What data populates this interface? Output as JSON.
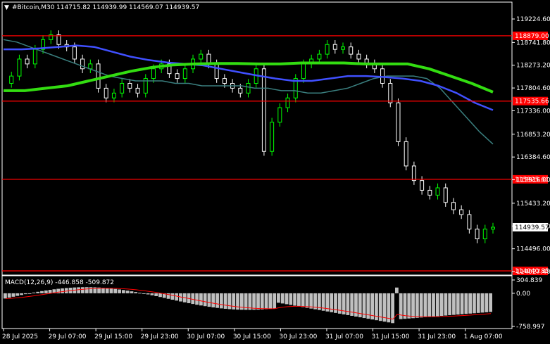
{
  "header": {
    "symbol_timeframe": "#Bitcoin,M30",
    "ohlc": "114715.82 114939.99 114569.07 114939.57",
    "menu_glyph": "▼"
  },
  "price_axis": {
    "ticks": [
      "119224.60",
      "118741.80",
      "118273.20",
      "117804.60",
      "117336.00",
      "116853.20",
      "116384.60",
      "115916.00",
      "115433.20",
      "114964.60",
      "114496.00",
      "114027.40"
    ],
    "current_price": "114939.57"
  },
  "level_lines": [
    {
      "price": "118879.00",
      "value": 118879.0
    },
    {
      "price": "117535.66",
      "value": 117535.66
    },
    {
      "price": "115925.61",
      "value": 115925.61
    },
    {
      "price": "114040.85",
      "value": 114040.85
    }
  ],
  "macd": {
    "label": "MACD(12,26,9) -446.858 -509.872",
    "ticks": [
      "304.839",
      "0.00",
      "-758.997"
    ]
  },
  "time_axis": [
    "28 Jul 2025",
    "29 Jul 07:00",
    "29 Jul 15:00",
    "29 Jul 23:00",
    "30 Jul 07:00",
    "30 Jul 15:00",
    "30 Jul 23:00",
    "31 Jul 07:00",
    "31 Jul 15:00",
    "31 Jul 23:00",
    "1 Aug 07:00"
  ],
  "colors": {
    "background": "#000000",
    "up_candle": "#00ff00",
    "down_candle": "#ffffff",
    "level": "#ff0000",
    "ma_fast": "#3a7f7f",
    "ma_mid": "#4050ff",
    "ma_slow": "#33dd11",
    "macd_hist": "#c0c0c0",
    "macd_signal": "#ff0000"
  },
  "chart_data": {
    "type": "candlestick",
    "title": "#Bitcoin,M30",
    "ylim": [
      114027.4,
      119224.6
    ],
    "close_series": [
      117900,
      118050,
      118400,
      118300,
      118600,
      118800,
      118900,
      118700,
      118650,
      118400,
      118200,
      118300,
      117800,
      117600,
      117700,
      117900,
      117800,
      117700,
      118000,
      118200,
      118300,
      118100,
      118000,
      118200,
      118400,
      118500,
      118300,
      118000,
      117900,
      117800,
      117700,
      117900,
      118200,
      116500,
      117100,
      117400,
      117600,
      118000,
      118300,
      118400,
      118500,
      118700,
      118600,
      118650,
      118500,
      118400,
      118300,
      118200,
      117900,
      117500,
      116700,
      116200,
      115900,
      115700,
      115600,
      115750,
      115450,
      115300,
      115200,
      114900,
      114700,
      114900,
      114939.57
    ],
    "ma_fast": [
      118800,
      118750,
      118650,
      118550,
      118450,
      118350,
      118250,
      118150,
      118050,
      118000,
      117950,
      117950,
      117950,
      117900,
      117900,
      117850,
      117850,
      117850,
      117850,
      117800,
      117800,
      117750,
      117750,
      117700,
      117700,
      117750,
      117800,
      117900,
      118000,
      118050,
      118050,
      118050,
      118000,
      117800,
      117500,
      117200,
      116900,
      116650
    ],
    "ma_mid": [
      118600,
      118600,
      118620,
      118650,
      118680,
      118650,
      118550,
      118450,
      118380,
      118330,
      118300,
      118270,
      118200,
      118130,
      118060,
      118000,
      117950,
      117950,
      118000,
      118050,
      118050,
      118030,
      118000,
      117950,
      117850,
      117700,
      117500,
      117350
    ],
    "ma_slow": [
      117750,
      117750,
      117800,
      117850,
      117950,
      118050,
      118150,
      118230,
      118280,
      118300,
      118310,
      118310,
      118300,
      118300,
      118320,
      118320,
      118320,
      118300,
      118300,
      118300,
      118200,
      118050,
      117900,
      117720
    ],
    "levels": [
      118879.0,
      117535.66,
      115925.61,
      114040.85
    ],
    "macd_histogram_range": [
      -758.997,
      304.839
    ]
  }
}
